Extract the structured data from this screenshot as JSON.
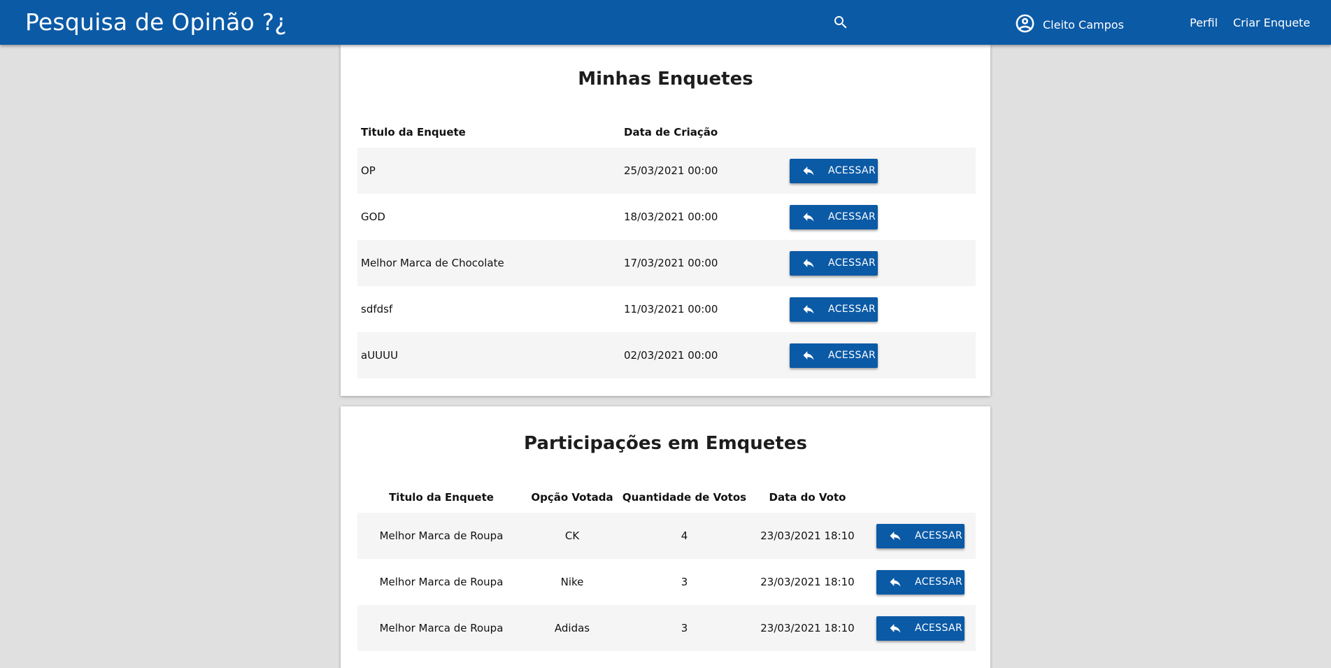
{
  "header": {
    "brand": "Pesquisa de Opinão ?¿",
    "user_name": "Cleito Campos",
    "nav": [
      "Perfil",
      "Criar Enquete"
    ]
  },
  "my_polls": {
    "title": "Minhas Enquetes",
    "columns": [
      "Titulo da Enquete",
      "Data de Criação"
    ],
    "rows": [
      {
        "title": "OP",
        "date": "25/03/2021 00:00"
      },
      {
        "title": "GOD",
        "date": "18/03/2021 00:00"
      },
      {
        "title": "Melhor Marca de Chocolate",
        "date": "17/03/2021 00:00"
      },
      {
        "title": "sdfdsf",
        "date": "11/03/2021 00:00"
      },
      {
        "title": "aUUUU",
        "date": "02/03/2021 00:00"
      }
    ],
    "action_label": "ACESSAR"
  },
  "participations": {
    "title": "Participações em Emquetes",
    "columns": [
      "Titulo da Enquete",
      "Opção Votada",
      "Quantidade de Votos",
      "Data do Voto"
    ],
    "rows": [
      {
        "title": "Melhor Marca de Roupa",
        "option": "CK",
        "votes": "4",
        "date": "23/03/2021 18:10"
      },
      {
        "title": "Melhor Marca de Roupa",
        "option": "Nike",
        "votes": "3",
        "date": "23/03/2021 18:10"
      },
      {
        "title": "Melhor Marca de Roupa",
        "option": "Adidas",
        "votes": "3",
        "date": "23/03/2021 18:10"
      }
    ],
    "action_label": "ACESSAR"
  },
  "colors": {
    "primary": "#0b5aa6",
    "background": "#e0e0e0",
    "row_stripe": "#f5f5f5"
  }
}
